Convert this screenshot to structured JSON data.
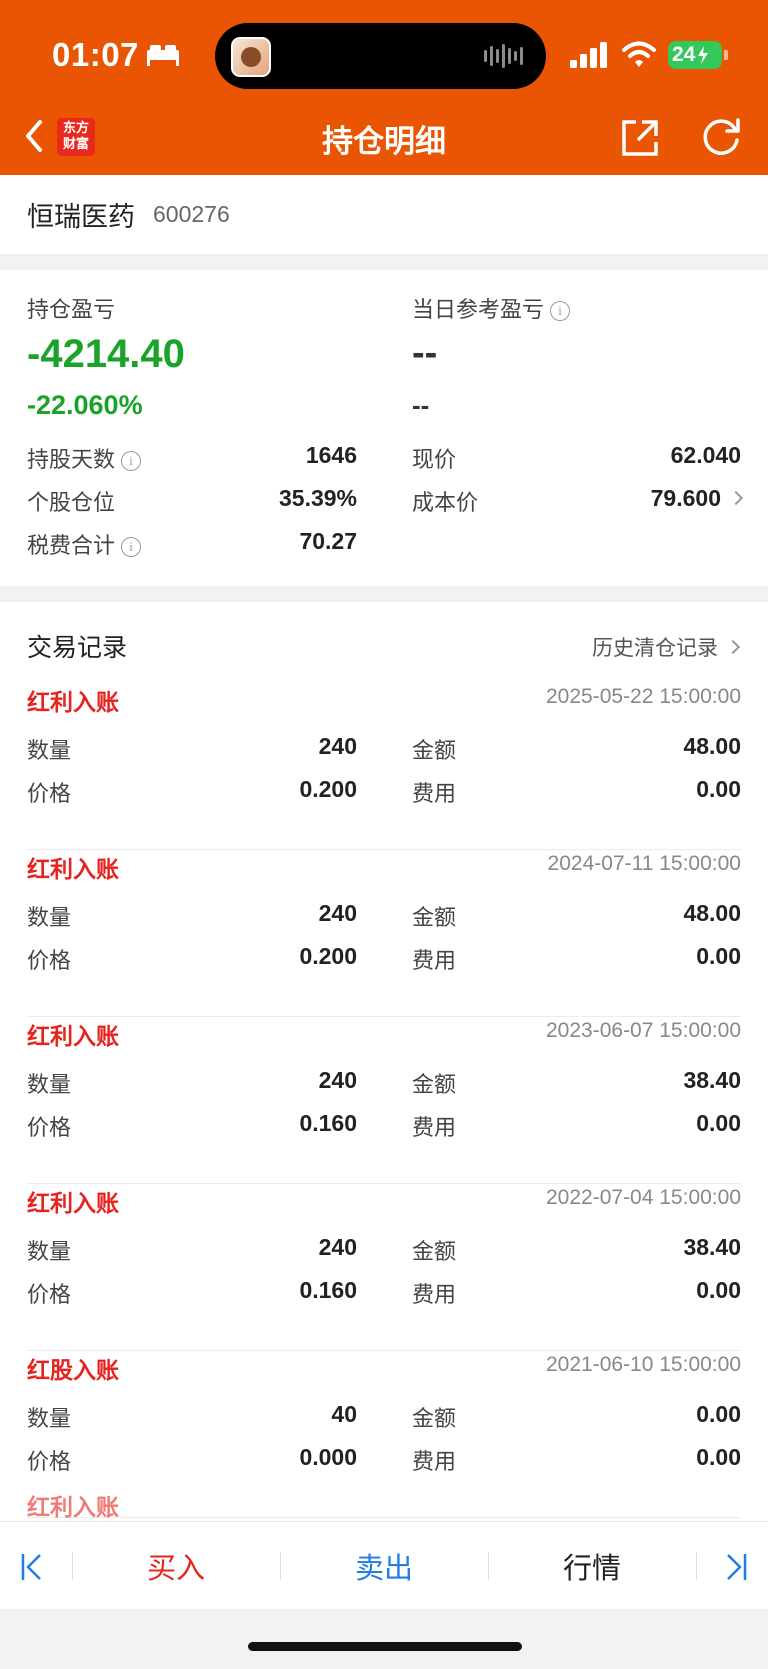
{
  "status_bar": {
    "time": "01:07",
    "battery": "24"
  },
  "nav": {
    "title": "持仓明细",
    "logo_line1": "东方",
    "logo_line2": "财富"
  },
  "stock": {
    "name": "恒瑞医药",
    "code": "600276"
  },
  "summary": {
    "position_pl_label": "持仓盈亏",
    "position_pl_value": "-4214.40",
    "position_pl_pct": "-22.060%",
    "day_pl_label": "当日参考盈亏",
    "day_pl_value": "--",
    "day_pl_pct": "--",
    "holding_days_label": "持股天数",
    "holding_days_value": "1646",
    "position_ratio_label": "个股仓位",
    "position_ratio_value": "35.39%",
    "tax_total_label": "税费合计",
    "tax_total_value": "70.27",
    "price_label": "现价",
    "price_value": "62.040",
    "cost_label": "成本价",
    "cost_value": "79.600"
  },
  "records": {
    "title": "交易记录",
    "history_link": "历史清仓记录",
    "labels": {
      "qty": "数量",
      "price": "价格",
      "amount": "金额",
      "fee": "费用"
    },
    "items": [
      {
        "type": "红利入账",
        "time": "2025-05-22 15:00:00",
        "qty": "240",
        "price": "0.200",
        "amount": "48.00",
        "fee": "0.00"
      },
      {
        "type": "红利入账",
        "time": "2024-07-11 15:00:00",
        "qty": "240",
        "price": "0.200",
        "amount": "48.00",
        "fee": "0.00"
      },
      {
        "type": "红利入账",
        "time": "2023-06-07 15:00:00",
        "qty": "240",
        "price": "0.160",
        "amount": "38.40",
        "fee": "0.00"
      },
      {
        "type": "红利入账",
        "time": "2022-07-04 15:00:00",
        "qty": "240",
        "price": "0.160",
        "amount": "38.40",
        "fee": "0.00"
      },
      {
        "type": "红股入账",
        "time": "2021-06-10 15:00:00",
        "qty": "40",
        "price": "0.000",
        "amount": "0.00",
        "fee": "0.00"
      }
    ],
    "partial_next_type": "红利入账"
  },
  "bottom_bar": {
    "buy": "买入",
    "sell": "卖出",
    "quote": "行情"
  },
  "colors": {
    "brand": "#ea5503",
    "loss": "#1aa328",
    "record_type": "#e52420",
    "buy": "#e52420",
    "sell": "#1f7ce8"
  }
}
